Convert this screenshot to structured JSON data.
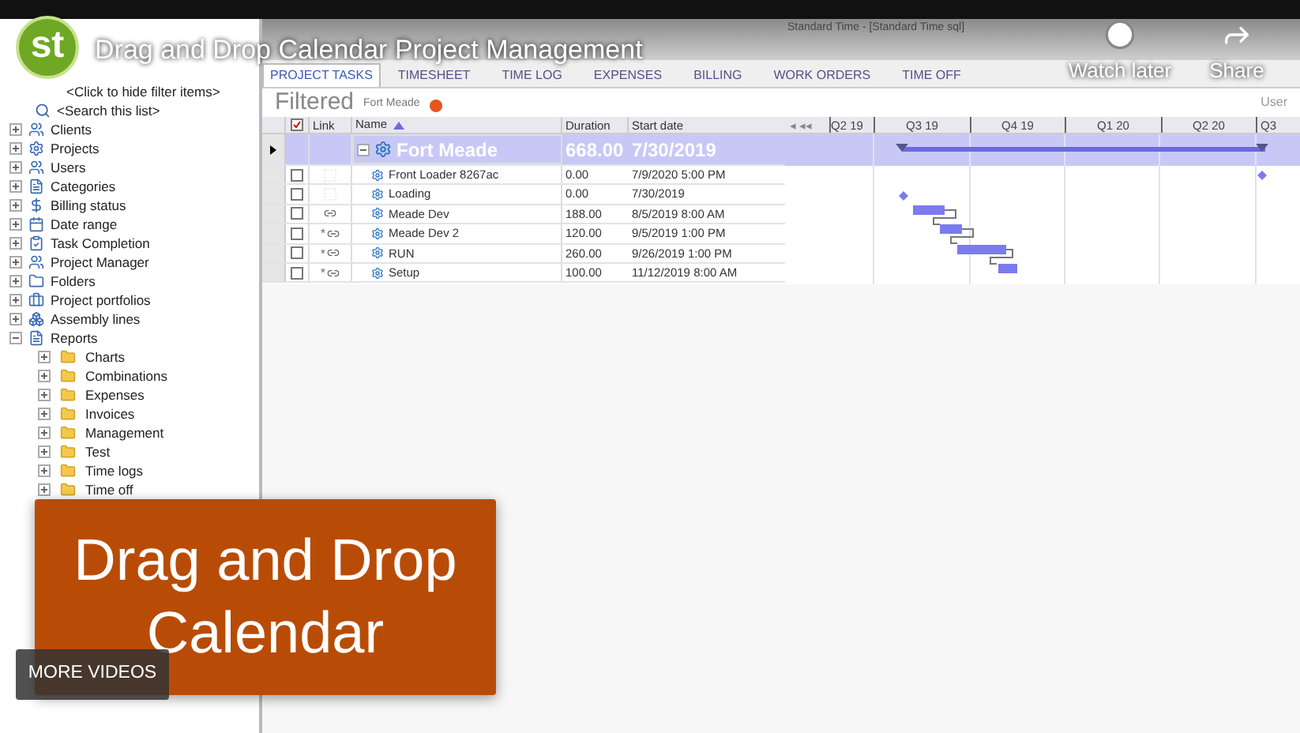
{
  "video": {
    "title": "Drag and Drop Calendar Project Management",
    "watch_later": "Watch later",
    "share": "Share",
    "logo": "st",
    "card_lines": [
      "Drag and Drop",
      "Calendar"
    ],
    "more_videos": "MORE VIDEOS"
  },
  "app": {
    "window_title": "Standard Time - [Standard Time sql]",
    "tree": [
      {
        "label": "<Click to hide filter items>",
        "kind": "plain"
      },
      {
        "label": "<Search this list>",
        "kind": "search"
      },
      {
        "label": "Clients",
        "kind": "node",
        "expanded": false
      },
      {
        "label": "Projects",
        "kind": "node",
        "expanded": false
      },
      {
        "label": "Users",
        "kind": "node",
        "expanded": false
      },
      {
        "label": "Categories",
        "kind": "node",
        "expanded": false
      },
      {
        "label": "Billing status",
        "kind": "node",
        "expanded": false
      },
      {
        "label": "Date range",
        "kind": "node",
        "expanded": false
      },
      {
        "label": "Task Completion",
        "kind": "node",
        "expanded": false
      },
      {
        "label": "Project Manager",
        "kind": "node",
        "expanded": false
      },
      {
        "label": "Folders",
        "kind": "node",
        "expanded": false
      },
      {
        "label": "Project portfolios",
        "kind": "node",
        "expanded": false
      },
      {
        "label": "Assembly lines",
        "kind": "node",
        "expanded": false
      },
      {
        "label": "Reports",
        "kind": "node",
        "expanded": true,
        "children": [
          {
            "label": "Charts",
            "expanded": false
          },
          {
            "label": "Combinations",
            "expanded": false
          },
          {
            "label": "Expenses",
            "expanded": false
          },
          {
            "label": "Invoices",
            "expanded": false
          },
          {
            "label": "Management",
            "expanded": false
          },
          {
            "label": "Test",
            "expanded": false
          },
          {
            "label": "Time logs",
            "expanded": false
          },
          {
            "label": "Time off",
            "expanded": false
          }
        ]
      }
    ],
    "tabs": [
      {
        "label": "PROJECT TASKS",
        "selected": true
      },
      {
        "label": "TIMESHEET",
        "selected": false
      },
      {
        "label": "TIME LOG",
        "selected": false
      },
      {
        "label": "EXPENSES",
        "selected": false
      },
      {
        "label": "BILLING",
        "selected": false
      },
      {
        "label": "WORK ORDERS",
        "selected": false
      },
      {
        "label": "TIME OFF",
        "selected": false
      }
    ],
    "filtered_label": "Filtered",
    "filter_value": "Fort Meade",
    "user_label": "User",
    "columns": {
      "all_checked": true,
      "link": "Link",
      "name": "Name",
      "duration": "Duration",
      "start": "Start date"
    },
    "timeline_nav": "◂ ◂◂",
    "quarters": [
      "Q2 19",
      "Q3 19",
      "Q4 19",
      "Q1 20",
      "Q2 20",
      "Q3"
    ],
    "rows": [
      {
        "kind": "summary",
        "selected": true,
        "name": "Fort Meade",
        "duration": "668.00",
        "start": "7/30/2019"
      },
      {
        "kind": "task",
        "selected": false,
        "checked": false,
        "linked": false,
        "name": "Front Loader 8267ac",
        "duration": "0.00",
        "start": "7/9/2020 5:00 PM"
      },
      {
        "kind": "task",
        "selected": false,
        "checked": false,
        "linked": false,
        "name": "Loading",
        "duration": "0.00",
        "start": "7/30/2019"
      },
      {
        "kind": "task",
        "selected": false,
        "checked": false,
        "linked": true,
        "name": "Meade Dev",
        "duration": "188.00",
        "start": "8/5/2019 8:00 AM"
      },
      {
        "kind": "task",
        "selected": false,
        "checked": false,
        "linked": true,
        "link_prefix": "*",
        "name": "Meade Dev 2",
        "duration": "120.00",
        "start": "9/5/2019 1:00 PM"
      },
      {
        "kind": "task",
        "selected": false,
        "checked": false,
        "linked": true,
        "link_prefix": "*",
        "name": "RUN",
        "duration": "260.00",
        "start": "9/26/2019 1:00 PM"
      },
      {
        "kind": "task",
        "selected": false,
        "checked": false,
        "linked": true,
        "link_prefix": "*",
        "name": "Setup",
        "duration": "100.00",
        "start": "11/12/2019 8:00 AM"
      }
    ]
  }
}
